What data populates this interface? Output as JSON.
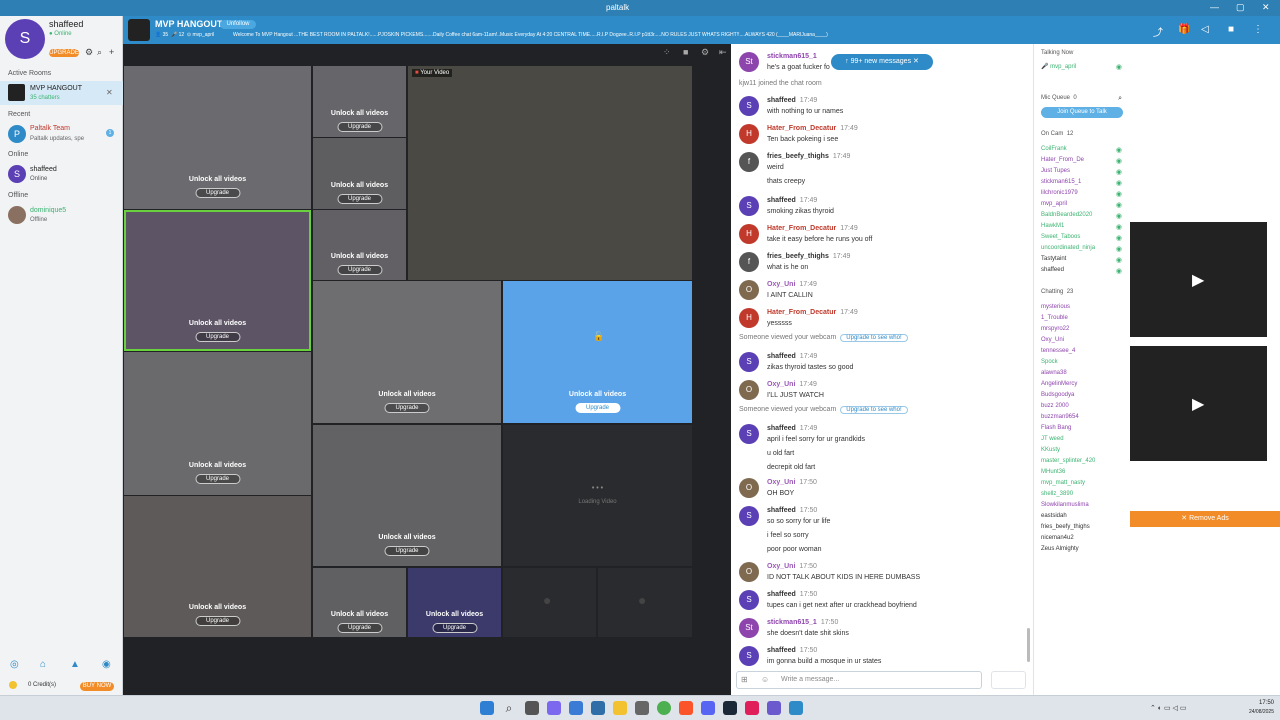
{
  "window": {
    "title": "paltalk"
  },
  "profile": {
    "initial": "S",
    "name": "shaffeed",
    "status": "Online",
    "upgrade": "UPGRADE"
  },
  "sidebar": {
    "active_rooms_label": "Active Rooms",
    "active_room": {
      "name": "MVP HANGOUT",
      "sub": "35 chatters"
    },
    "recent_label": "Recent",
    "recent": {
      "name": "Paltalk Team",
      "sub": "Paltalk updates, spe",
      "badge": "1"
    },
    "online_label": "Online",
    "online_user": {
      "initial": "S",
      "name": "shaffeed",
      "status": "Online"
    },
    "offline_label": "Offline",
    "offline_user": {
      "name": "dominique5",
      "status": "Offline"
    },
    "credits": "0 Credit(s)",
    "buy_now": "BUY NOW"
  },
  "room": {
    "name": "MVP HANGOUT",
    "unfollow": "Unfollow",
    "stats": [
      "35",
      "12",
      "mvp_april"
    ],
    "ticker": "Welcome To MVP Hangout ...THE BEST ROOM IN PALTALK!......PJOSKIN PICKEMS.......Daily Coffee chat 6am-11am!..Music Everyday At 4:20 CENTRAL TIME.....R.I.P Dogzee..R.I.P p1tt3r.....NO RULES JUST WHATS RIGHT!!....ALWAYS 420 (____MARIJuana____)"
  },
  "video": {
    "unlock": "Unlock all videos",
    "upgrade": "Upgrade",
    "your_video": "Your Video",
    "loading": "Loading Video"
  },
  "chat": {
    "new_messages": "99+ new messages",
    "joined": "kjw11 joined the chat room",
    "viewed": "Someone viewed your webcam",
    "see_who": "Upgrade to see who!",
    "input_placeholder": "Write a message...",
    "messages": [
      {
        "initial": "St",
        "name": "stickman615_1",
        "time": "",
        "lines": [
          "he's a goat fucker fo"
        ],
        "color": "#8e44ad"
      },
      {
        "initial": "S",
        "name": "shaffeed",
        "time": "17:49",
        "lines": [
          "with nothing to ur names"
        ],
        "color": "#5b3fb5"
      },
      {
        "initial": "H",
        "name": "Hater_From_Decatur",
        "time": "17:49",
        "lines": [
          "Ten back pokeing i see"
        ],
        "color": "#c0392b"
      },
      {
        "initial": "f",
        "name": "fries_beefy_thighs",
        "time": "17:49",
        "lines": [
          "weird",
          "thats creepy"
        ],
        "color": "#555555"
      },
      {
        "initial": "S",
        "name": "shaffeed",
        "time": "17:49",
        "lines": [
          "smoking zikas thyroid"
        ],
        "color": "#5b3fb5"
      },
      {
        "initial": "H",
        "name": "Hater_From_Decatur",
        "time": "17:49",
        "lines": [
          "take it easy before he runs you off"
        ],
        "color": "#c0392b"
      },
      {
        "initial": "f",
        "name": "fries_beefy_thighs",
        "time": "17:49",
        "lines": [
          "what is he on"
        ],
        "color": "#555555"
      },
      {
        "initial": "O",
        "name": "Oxy_Uni",
        "time": "17:49",
        "lines": [
          "I AINT CALLIN"
        ],
        "color": "#7f6a50"
      },
      {
        "initial": "H",
        "name": "Hater_From_Decatur",
        "time": "17:49",
        "lines": [
          "yesssss"
        ],
        "color": "#c0392b"
      },
      {
        "initial": "S",
        "name": "shaffeed",
        "time": "17:49",
        "lines": [
          "zikas thyroid tastes so good"
        ],
        "color": "#5b3fb5"
      },
      {
        "initial": "O",
        "name": "Oxy_Uni",
        "time": "17:49",
        "lines": [
          "I'LL JUST WATCH"
        ],
        "color": "#7f6a50"
      },
      {
        "initial": "S",
        "name": "shaffeed",
        "time": "17:49",
        "lines": [
          "april i feel sorry for ur grandkids",
          "u old fart",
          "decrepit old fart"
        ],
        "color": "#5b3fb5"
      },
      {
        "initial": "O",
        "name": "Oxy_Uni",
        "time": "17:50",
        "lines": [
          "OH BOY"
        ],
        "color": "#7f6a50"
      },
      {
        "initial": "S",
        "name": "shaffeed",
        "time": "17:50",
        "lines": [
          "so so sorry for ur life",
          "i feel so sorry",
          "poor poor woman"
        ],
        "color": "#5b3fb5"
      },
      {
        "initial": "O",
        "name": "Oxy_Uni",
        "time": "17:50",
        "lines": [
          "ID NOT TALK ABOUT KIDS IN HERE DUMBASS"
        ],
        "color": "#7f6a50"
      },
      {
        "initial": "S",
        "name": "shaffeed",
        "time": "17:50",
        "lines": [
          "tupes can i get next after ur crackhead boyfriend"
        ],
        "color": "#5b3fb5"
      },
      {
        "initial": "St",
        "name": "stickman615_1",
        "time": "17:50",
        "lines": [
          "she doesn't date shit skins"
        ],
        "color": "#8e44ad"
      },
      {
        "initial": "S",
        "name": "shaffeed",
        "time": "17:50",
        "lines": [
          "im gonna build a mosque in ur states"
        ],
        "color": "#5b3fb5"
      }
    ]
  },
  "users": {
    "talking_now": "Talking Now",
    "talker": "mvp_april",
    "mic_queue": "Mic Queue",
    "mic_count": "0",
    "join_queue": "Join Queue to Talk",
    "on_cam": "On Cam",
    "on_cam_count": "12",
    "cam_users": [
      "CoilFrank",
      "Hater_From_De",
      "Just Tupes",
      "stickman615_1",
      "lilchronic1979",
      "mvp_april",
      "BaldnBearded2020",
      "HawkM1",
      "Sweet_Taboos",
      "uncoordinated_ninja",
      "Tastytaint",
      "shaffeed"
    ],
    "chatting": "Chatting",
    "chatting_count": "23",
    "chat_users": [
      "mysterious",
      "1_Trouble",
      "mrspyro22",
      "Oxy_Uni",
      "tennessee_4",
      "Spock",
      "alawna38",
      "AngelinMercy",
      "Budsgoodya",
      "buzz 2000",
      "buzzman9654",
      "Flash Bang",
      "JT weed",
      "KKusty",
      "master_splinter_420",
      "MHunt36",
      "mvp_matt_nasty",
      "shellz_3890",
      "Slowkilanmuslima",
      "eastsidah",
      "fries_beefy_thighs",
      "niceman4u2",
      "Zeus Almighty"
    ]
  },
  "ads": {
    "remove": "Remove Ads"
  },
  "taskbar": {
    "time": "17:50",
    "date": "24/08/2025"
  }
}
